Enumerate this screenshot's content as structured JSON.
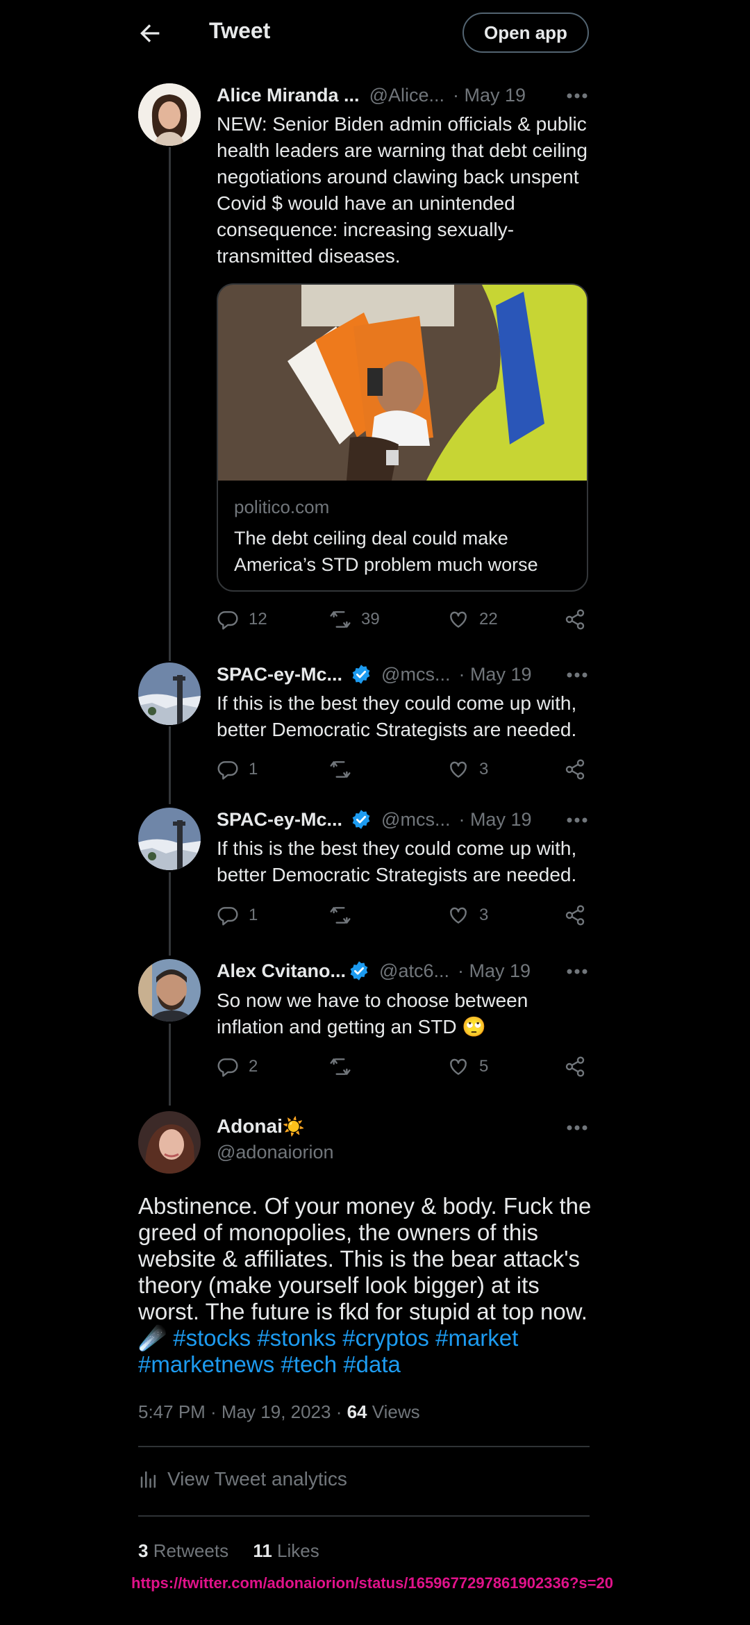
{
  "header": {
    "title": "Tweet",
    "open_app": "Open app"
  },
  "colors": {
    "accent": "#1d9bf0",
    "muted": "#71767b",
    "url": "#e0128a"
  },
  "thread": [
    {
      "name": "Alice Miranda ...",
      "handle": "@Alice...",
      "date": "· May 19",
      "text": "NEW: Senior Biden admin officials & public health leaders are warning that debt ceiling negotiations around clawing back unspent Covid $ would have an unintended consequence: increasing sexually-transmitted diseases.",
      "card": {
        "domain": "politico.com",
        "title": "The debt ceiling deal could make America’s STD problem much worse"
      },
      "replies": "12",
      "retweets": "39",
      "likes": "22"
    },
    {
      "name": "SPAC-ey-Mc...",
      "handle": "@mcs...",
      "date": "· May 19",
      "text": "If this is the best they could come up with, better Democratic Strategists are needed.",
      "replies": "1",
      "retweets": "",
      "likes": "3"
    },
    {
      "name": "SPAC-ey-Mc...",
      "handle": "@mcs...",
      "date": "· May 19",
      "text": "If this is the best they could come up with, better Democratic Strategists are needed.",
      "replies": "1",
      "retweets": "",
      "likes": "3"
    },
    {
      "name": "Alex Cvitano...",
      "handle": "@atc6...",
      "date": "· May 19",
      "text": "So now we have to choose between inflation and getting an STD 🙄",
      "replies": "2",
      "retweets": "",
      "likes": "5"
    }
  ],
  "main": {
    "name": "Adonai",
    "name_emoji": "☀️",
    "handle": "@adonaiorion",
    "text": "Abstinence. Of your money & body. Fuck the greed of monopolies, the owners of this website & affiliates. This is the bear attack's theory (make yourself look bigger) at its worst. The future is fkd for stupid at top now.",
    "emoji": "☄️",
    "hashtags": [
      "#stocks",
      "#stonks",
      "#cryptos",
      "#market",
      "#marketnews",
      "#tech",
      "#data"
    ],
    "time": "5:47 PM · May 19, 2023 · ",
    "views_count": "64",
    "views_label": " Views",
    "analytics": "View Tweet analytics",
    "retweets_count": "3",
    "retweets_label": " Retweets",
    "likes_count": "11",
    "likes_label": " Likes"
  },
  "footer_url": "https://twitter.com/adonaiorion/status/1659677297861902336?s=20"
}
